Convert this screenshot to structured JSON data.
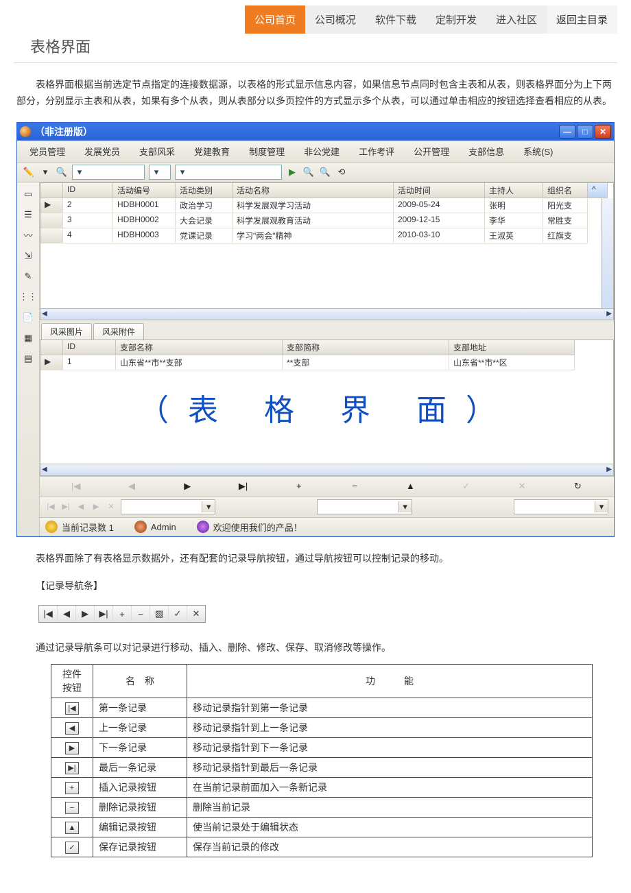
{
  "nav": {
    "items": [
      {
        "label": "公司首页",
        "active": true
      },
      {
        "label": "公司概况"
      },
      {
        "label": "软件下载"
      },
      {
        "label": "定制开发"
      },
      {
        "label": "进入社区"
      },
      {
        "label": "返回主目录",
        "back": true
      }
    ]
  },
  "page_title": "表格界面",
  "intro_para": "表格界面根据当前选定节点指定的连接数据源，以表格的形式显示信息内容，如果信息节点同时包含主表和从表，则表格界面分为上下两部分，分别显示主表和从表，如果有多个从表，则从表部分以多页控件的方式显示多个从表，可以通过单击相应的按钮选择查看相应的从表。",
  "window": {
    "title": "（非注册版）",
    "menu": [
      "党员管理",
      "发展党员",
      "支部风采",
      "党建教育",
      "制度管理",
      "非公党建",
      "工作考评",
      "公开管理",
      "支部信息",
      "系统(S)"
    ],
    "master": {
      "headers": [
        "ID",
        "活动编号",
        "活动类别",
        "活动名称",
        "活动时间",
        "主持人",
        "组织名"
      ],
      "rows": [
        {
          "id": "2",
          "no": "HDBH0001",
          "type": "政治学习",
          "name": "科学发展观学习活动",
          "time": "2009-05-24",
          "host": "张明",
          "org": "阳光支"
        },
        {
          "id": "3",
          "no": "HDBH0002",
          "type": "大会记录",
          "name": "科学发展观教育活动",
          "time": "2009-12-15",
          "host": "李华",
          "org": "常胜支"
        },
        {
          "id": "4",
          "no": "HDBH0003",
          "type": "党课记录",
          "name": "学习\"两会\"精神",
          "time": "2010-03-10",
          "host": "王淑英",
          "org": "红旗支"
        }
      ]
    },
    "tabs": [
      "风采图片",
      "风采附件"
    ],
    "detail": {
      "headers": [
        "ID",
        "支部名称",
        "支部简称",
        "支部地址"
      ],
      "rows": [
        {
          "id": "1",
          "name": "山东省**市**支部",
          "short": "**支部",
          "addr": "山东省**市**区"
        }
      ]
    },
    "watermark": "（表 格 界 面）",
    "status": {
      "records": "当前记录数 1",
      "user": "Admin",
      "welcome": "欢迎使用我们的产品！"
    }
  },
  "para2": "表格界面除了有表格显示数据外，还有配套的记录导航按钮，通过导航按钮可以控制记录的移动。",
  "section_title": "【记录导航条】",
  "para3": "通过记录导航条可以对记录进行移动、插入、删除、修改、保存、取消修改等操作。",
  "func_table": {
    "headers": [
      "控件\n按钮",
      "名　称",
      "功　　　能"
    ],
    "rows": [
      {
        "glyph": "|◀",
        "name": "第一条记录",
        "func": "移动记录指针到第一条记录"
      },
      {
        "glyph": "◀",
        "name": "上一条记录",
        "func": "移动记录指针到上一条记录"
      },
      {
        "glyph": "▶",
        "name": "下一条记录",
        "func": "移动记录指针到下一条记录"
      },
      {
        "glyph": "▶|",
        "name": "最后一条记录",
        "func": "移动记录指针到最后一条记录"
      },
      {
        "glyph": "+",
        "name": "插入记录按钮",
        "func": "在当前记录前面加入一条新记录"
      },
      {
        "glyph": "−",
        "name": "删除记录按钮",
        "func": "删除当前记录"
      },
      {
        "glyph": "▲",
        "name": "编辑记录按钮",
        "func": "使当前记录处于编辑状态"
      },
      {
        "glyph": "✓",
        "name": "保存记录按钮",
        "func": "保存当前记录的修改"
      }
    ]
  },
  "navstrip_glyphs": [
    "|◀",
    "◀",
    "▶",
    "▶|",
    "+",
    "−",
    "▧",
    "✓",
    "✕"
  ]
}
